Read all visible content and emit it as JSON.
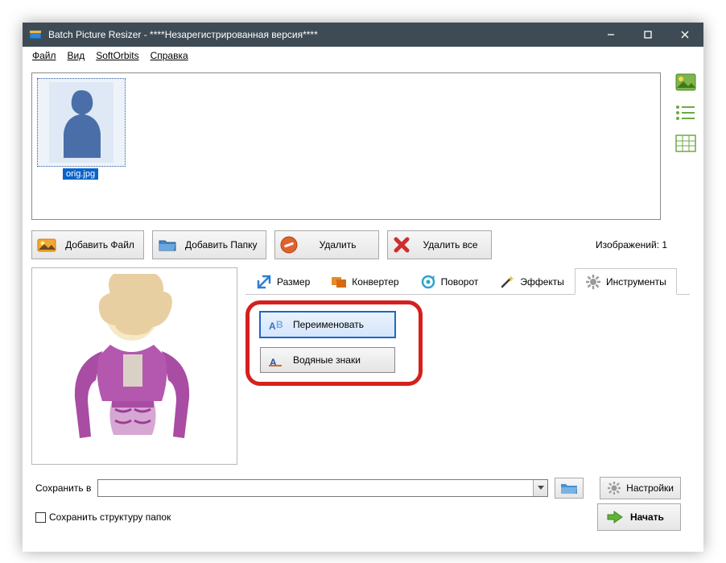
{
  "window": {
    "title": "Batch Picture Resizer - ****Незарегистрированная версия****"
  },
  "menu": {
    "file": "Файл",
    "view": "Вид",
    "softorbits": "SoftOrbits",
    "help": "Справка"
  },
  "thumbs": {
    "file_label": "orig.jpg"
  },
  "toolbar": {
    "add_file": "Добавить Файл",
    "add_folder": "Добавить Папку",
    "delete": "Удалить",
    "delete_all": "Удалить все",
    "image_count_label": "Изображений:  1"
  },
  "tabs": {
    "size": "Размер",
    "converter": "Конвертер",
    "rotate": "Поворот",
    "effects": "Эффекты",
    "tools": "Инструменты"
  },
  "tools_panel": {
    "rename": "Переименовать",
    "watermark": "Водяные знаки"
  },
  "save": {
    "label": "Сохранить в",
    "value": "",
    "settings": "Настройки",
    "keep_folder_structure": "Сохранить структуру папок"
  },
  "actions": {
    "start": "Начать"
  }
}
